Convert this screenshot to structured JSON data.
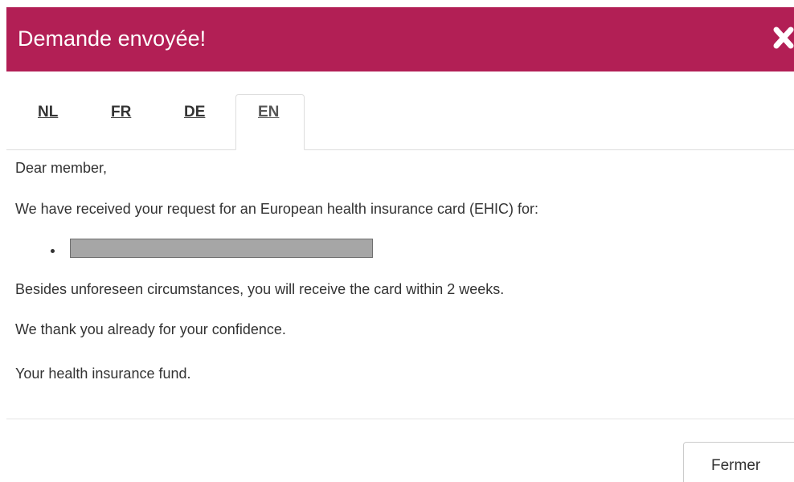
{
  "dialog": {
    "title": "Demande envoyée!",
    "header_color": "#b21f55",
    "close_icon": "close-x-icon"
  },
  "tabs": [
    {
      "label": "NL",
      "active": false
    },
    {
      "label": "FR",
      "active": false
    },
    {
      "label": "DE",
      "active": false
    },
    {
      "label": "EN",
      "active": true
    }
  ],
  "message": {
    "greeting": "Dear member,",
    "received": "We have received your request for an European health insurance card (EHIC) for:",
    "besides": "Besides unforeseen circumstances, you will receive the card within 2 weeks.",
    "thanks": "We thank you already for your confidence.",
    "signature": "Your health insurance fund."
  },
  "footer": {
    "close_label": "Fermer"
  }
}
